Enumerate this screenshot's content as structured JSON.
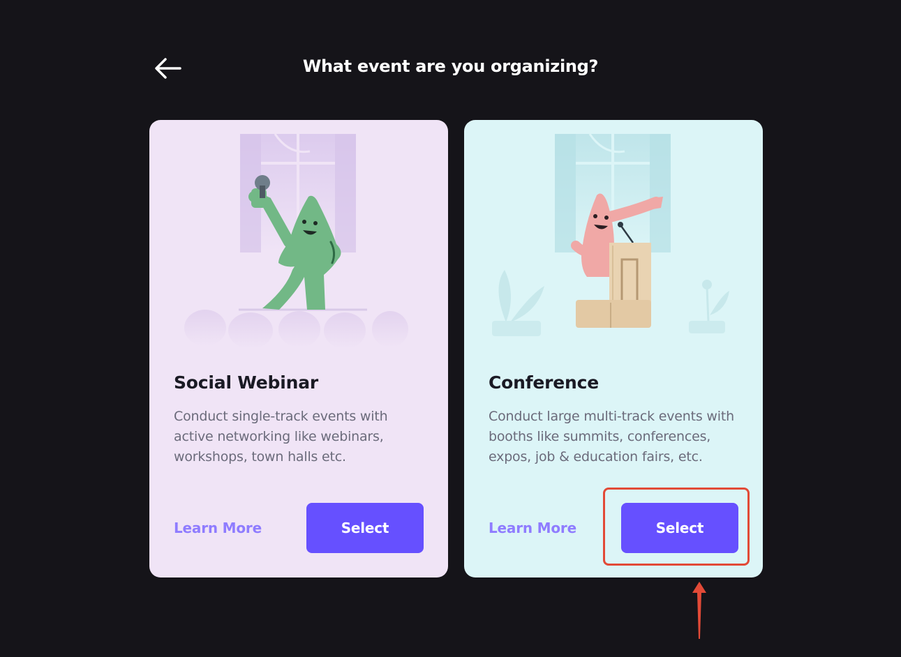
{
  "header": {
    "title": "What event are you organizing?",
    "back_icon": "arrow-left-icon"
  },
  "cards": [
    {
      "title": "Social Webinar",
      "description": "Conduct single-track events with active networking like webinars, workshops, town halls etc.",
      "learn_more_label": "Learn More",
      "select_label": "Select",
      "background": "#f0e4f6",
      "illustration": "speaker-with-microphone-illustration"
    },
    {
      "title": "Conference",
      "description": "Conduct large multi-track events with booths like summits, conferences, expos, job & education fairs, etc.",
      "learn_more_label": "Learn More",
      "select_label": "Select",
      "background": "#dcf5f7",
      "illustration": "speaker-at-podium-illustration"
    }
  ],
  "colors": {
    "page_background": "#151419",
    "accent": "#6650ff",
    "link": "#8f7cff",
    "annotation": "#e24a37"
  }
}
